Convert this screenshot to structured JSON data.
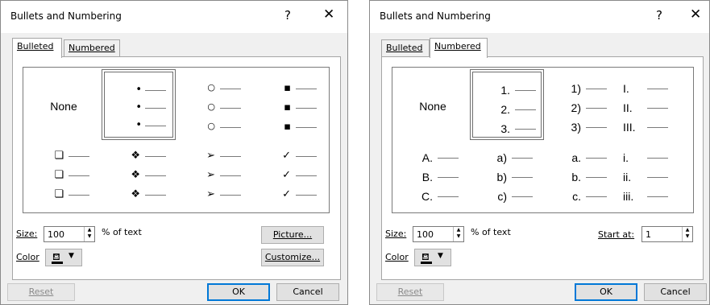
{
  "left": {
    "title": "Bullets and Numbering",
    "help": "?",
    "close": "✕",
    "tabs": [
      "Bulleted",
      "Numbered"
    ],
    "none_label": "None",
    "bullets": [
      "•",
      "○",
      "▪",
      "❏",
      "❖",
      "➢",
      "✓"
    ],
    "size_label": "Size:",
    "size_value": "100",
    "percent_label": "% of text",
    "color_label": "Color",
    "picture_button": "Picture...",
    "customize_button": "Customize...",
    "reset_button": "Reset",
    "ok_button": "OK",
    "cancel_button": "Cancel"
  },
  "right": {
    "title": "Bullets and Numbering",
    "help": "?",
    "close": "✕",
    "tabs": [
      "Bulleted",
      "Numbered"
    ],
    "none_label": "None",
    "numbering": [
      [
        "1.",
        "2.",
        "3."
      ],
      [
        "1)",
        "2)",
        "3)"
      ],
      [
        "I.",
        "II.",
        "III."
      ],
      [
        "A.",
        "B.",
        "C."
      ],
      [
        "a)",
        "b)",
        "c)"
      ],
      [
        "a.",
        "b.",
        "c."
      ],
      [
        "i.",
        "ii.",
        "iii."
      ]
    ],
    "size_label": "Size:",
    "size_value": "100",
    "percent_label": "% of text",
    "start_label": "Start at:",
    "start_value": "1",
    "color_label": "Color",
    "reset_button": "Reset",
    "ok_button": "OK",
    "cancel_button": "Cancel"
  }
}
